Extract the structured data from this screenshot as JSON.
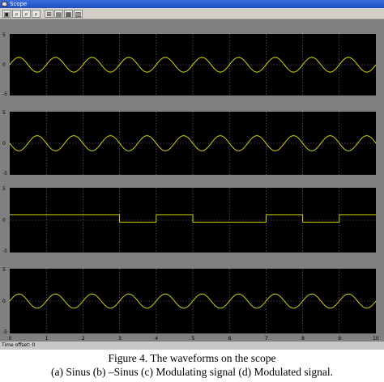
{
  "window": {
    "title": "Scope"
  },
  "toolbar": {
    "buttons": [
      {
        "name": "print-icon",
        "glyph": "▣"
      },
      {
        "name": "zoom-in-icon",
        "glyph": "⌕"
      },
      {
        "name": "zoom-x-icon",
        "glyph": "⌕"
      },
      {
        "name": "zoom-y-icon",
        "glyph": "⌕"
      },
      {
        "name": "autoscale-icon",
        "glyph": "⊞"
      },
      {
        "name": "save-axes-icon",
        "glyph": "▤"
      },
      {
        "name": "parameters-icon",
        "glyph": "▦"
      },
      {
        "name": "floating-scope-icon",
        "glyph": "▧"
      }
    ]
  },
  "colors": {
    "plot_bg": "#000000",
    "trace": "#e8e800",
    "grid": "#7a7a7a",
    "frame": "#808080"
  },
  "chart_data": [
    {
      "type": "line",
      "id": "a",
      "ylim": [
        -5,
        5
      ],
      "yticks": [
        "5",
        "0",
        "-5"
      ],
      "grid": true,
      "signal": "sine",
      "amplitude": 1.2,
      "cycles": 10,
      "offset": 0
    },
    {
      "type": "line",
      "id": "b",
      "ylim": [
        -5,
        5
      ],
      "yticks": [
        "5",
        "0",
        "-5"
      ],
      "grid": true,
      "signal": "sine",
      "amplitude": 1.2,
      "cycles": 10,
      "offset": 0,
      "phase": "inverted"
    },
    {
      "type": "line",
      "id": "c",
      "ylim": [
        -5,
        5
      ],
      "yticks": [
        "5",
        "0",
        "-5"
      ],
      "grid": true,
      "signal": "square",
      "segments": [
        {
          "x0": 0,
          "x1": 3,
          "y": 0.8
        },
        {
          "x0": 3,
          "x1": 4,
          "y": -0.3
        },
        {
          "x0": 4,
          "x1": 5,
          "y": 0.8
        },
        {
          "x0": 5,
          "x1": 7,
          "y": -0.3
        },
        {
          "x0": 7,
          "x1": 8,
          "y": 0.8
        },
        {
          "x0": 8,
          "x1": 9,
          "y": -0.3
        },
        {
          "x0": 9,
          "x1": 10,
          "y": 0.8
        }
      ]
    },
    {
      "type": "line",
      "id": "d",
      "ylim": [
        -5,
        5
      ],
      "yticks": [
        "5",
        "0",
        "-5"
      ],
      "grid": true,
      "signal": "sine",
      "amplitude": 1.1,
      "cycles": 10,
      "offset": 0,
      "xlim": [
        0,
        10
      ],
      "xticks": [
        "0",
        "1",
        "2",
        "3",
        "4",
        "5",
        "6",
        "7",
        "8",
        "9",
        "10"
      ]
    }
  ],
  "status": {
    "time_offset": "Time offset: 0"
  },
  "caption": {
    "line1": "Figure 4. The waveforms on the scope",
    "line2": "(a) Sinus (b) –Sinus (c) Modulating signal  (d) Modulated signal."
  }
}
